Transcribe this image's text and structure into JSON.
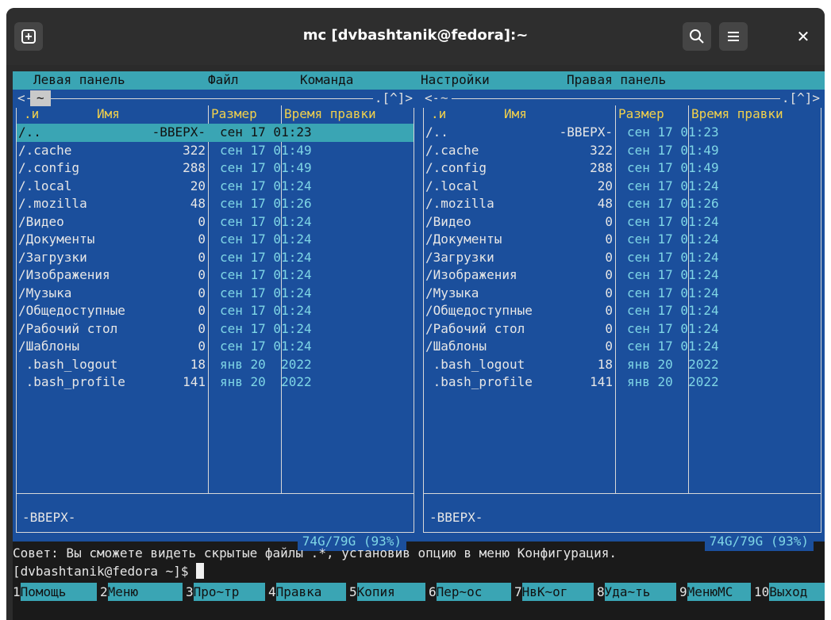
{
  "window": {
    "title": "mc [dvbashtanik@fedora]:~",
    "icons": [
      "new-tab-icon",
      "search-icon",
      "hamburger-menu-icon",
      "close-icon"
    ]
  },
  "menubar": {
    "items": [
      "Левая панель",
      "Файл",
      "Команда",
      "Настройки",
      "Правая панель"
    ]
  },
  "panels": {
    "left": {
      "path": "~",
      "controls_left": "<-",
      "controls_right": ".[^]>",
      "headers": {
        "sort": ".и",
        "name": "Имя",
        "size": "Размер",
        "time": "Время правки"
      },
      "rows": [
        {
          "name": "/..",
          "size": "-ВВЕРХ-",
          "time": "сен 17 01:23",
          "selected": true
        },
        {
          "name": "/.cache",
          "size": "322",
          "time": "сен 17 01:49"
        },
        {
          "name": "/.config",
          "size": "288",
          "time": "сен 17 01:49"
        },
        {
          "name": "/.local",
          "size": "20",
          "time": "сен 17 01:24"
        },
        {
          "name": "/.mozilla",
          "size": "48",
          "time": "сен 17 01:26"
        },
        {
          "name": "/Видео",
          "size": "0",
          "time": "сен 17 01:24"
        },
        {
          "name": "/Документы",
          "size": "0",
          "time": "сен 17 01:24"
        },
        {
          "name": "/Загрузки",
          "size": "0",
          "time": "сен 17 01:24"
        },
        {
          "name": "/Изображения",
          "size": "0",
          "time": "сен 17 01:24"
        },
        {
          "name": "/Музыка",
          "size": "0",
          "time": "сен 17 01:24"
        },
        {
          "name": "/Общедоступные",
          "size": "0",
          "time": "сен 17 01:24"
        },
        {
          "name": "/Рабочий стол",
          "size": "0",
          "time": "сен 17 01:24"
        },
        {
          "name": "/Шаблоны",
          "size": "0",
          "time": "сен 17 01:24"
        },
        {
          "name": " .bash_logout",
          "size": "18",
          "time": "янв 20  2022"
        },
        {
          "name": " .bash_profile",
          "size": "141",
          "time": "янв 20  2022"
        }
      ],
      "info": "-ВВЕРХ-",
      "disk": "74G/79G (93%)"
    },
    "right": {
      "path": "~",
      "controls_left": "<-",
      "controls_right": ".[^]>",
      "headers": {
        "sort": ".и",
        "name": "Имя",
        "size": "Размер",
        "time": "Время правки"
      },
      "rows": [
        {
          "name": "/..",
          "size": "-ВВЕРХ-",
          "time": "сен 17 01:23"
        },
        {
          "name": "/.cache",
          "size": "322",
          "time": "сен 17 01:49"
        },
        {
          "name": "/.config",
          "size": "288",
          "time": "сен 17 01:49"
        },
        {
          "name": "/.local",
          "size": "20",
          "time": "сен 17 01:24"
        },
        {
          "name": "/.mozilla",
          "size": "48",
          "time": "сен 17 01:26"
        },
        {
          "name": "/Видео",
          "size": "0",
          "time": "сен 17 01:24"
        },
        {
          "name": "/Документы",
          "size": "0",
          "time": "сен 17 01:24"
        },
        {
          "name": "/Загрузки",
          "size": "0",
          "time": "сен 17 01:24"
        },
        {
          "name": "/Изображения",
          "size": "0",
          "time": "сен 17 01:24"
        },
        {
          "name": "/Музыка",
          "size": "0",
          "time": "сен 17 01:24"
        },
        {
          "name": "/Общедоступные",
          "size": "0",
          "time": "сен 17 01:24"
        },
        {
          "name": "/Рабочий стол",
          "size": "0",
          "time": "сен 17 01:24"
        },
        {
          "name": "/Шаблоны",
          "size": "0",
          "time": "сен 17 01:24"
        },
        {
          "name": " .bash_logout",
          "size": "18",
          "time": "янв 20  2022"
        },
        {
          "name": " .bash_profile",
          "size": "141",
          "time": "янв 20  2022"
        }
      ],
      "info": "-ВВЕРХ-",
      "disk": "74G/79G (93%)"
    }
  },
  "hint": "Совет: Вы сможете видеть скрытые файлы .*, установив опцию в меню Конфигурация.",
  "prompt": "[dvbashtanik@fedora ~]$ ",
  "fkeys": [
    {
      "num": "1",
      "label": "Помощь"
    },
    {
      "num": "2",
      "label": "Меню"
    },
    {
      "num": "3",
      "label": "Про~тр"
    },
    {
      "num": "4",
      "label": "Правка"
    },
    {
      "num": "5",
      "label": "Копия"
    },
    {
      "num": "6",
      "label": "Пер~ос"
    },
    {
      "num": "7",
      "label": "НвК~ог"
    },
    {
      "num": "8",
      "label": "Уда~ть"
    },
    {
      "num": "9",
      "label": "МенюMC"
    },
    {
      "num": "10",
      "label": "Выход"
    }
  ],
  "colors": {
    "panel_bg": "#1b4f9c",
    "accent": "#3aa5b4",
    "header": "#f2d14b"
  }
}
